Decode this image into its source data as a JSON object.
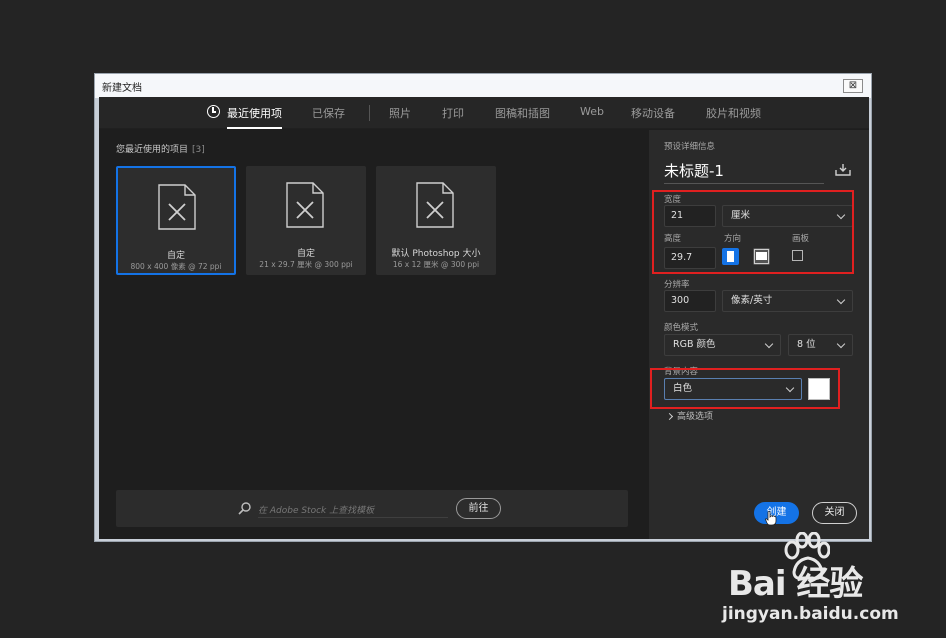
{
  "window": {
    "title": "新建文档",
    "close_glyph": "⊠"
  },
  "tabs": [
    {
      "label": "最近使用项",
      "active": true
    },
    {
      "label": "已保存",
      "active": false
    },
    {
      "label": "照片",
      "active": false
    },
    {
      "label": "打印",
      "active": false
    },
    {
      "label": "图稿和插图",
      "active": false
    },
    {
      "label": "Web",
      "active": false
    },
    {
      "label": "移动设备",
      "active": false
    },
    {
      "label": "胶片和视频",
      "active": false
    }
  ],
  "recent": {
    "label": "您最近使用的项目",
    "count": "[3]",
    "items": [
      {
        "name": "自定",
        "meta": "800 x 400 像素 @ 72 ppi",
        "selected": true
      },
      {
        "name": "自定",
        "meta": "21 x 29.7 厘米 @ 300 ppi",
        "selected": false
      },
      {
        "name": "默认 Photoshop 大小",
        "meta": "16 x 12 厘米 @ 300 ppi",
        "selected": false
      }
    ]
  },
  "stock": {
    "placeholder": "在 Adobe Stock 上查找模板",
    "go_label": "前往"
  },
  "preset": {
    "section_label": "预设详细信息",
    "doc_title": "未标题-1",
    "width_label": "宽度",
    "width_value": "21",
    "unit": "厘米",
    "height_label": "高度",
    "height_value": "29.7",
    "orientation_label": "方向",
    "artboard_label": "画板",
    "resolution_label": "分辨率",
    "resolution_value": "300",
    "resolution_unit": "像素/英寸",
    "color_mode_label": "颜色模式",
    "color_mode": "RGB 颜色",
    "bit_depth": "8 位",
    "background_label": "背景内容",
    "background": "白色",
    "advanced_label": "高级选项",
    "swatch_color": "#ffffff"
  },
  "buttons": {
    "create": "创建",
    "close": "关闭"
  },
  "watermark": {
    "logo": "Bai 经验",
    "url": "jingyan.baidu.com"
  },
  "colors": {
    "accent": "#1473e6",
    "highlight": "#e02020"
  }
}
